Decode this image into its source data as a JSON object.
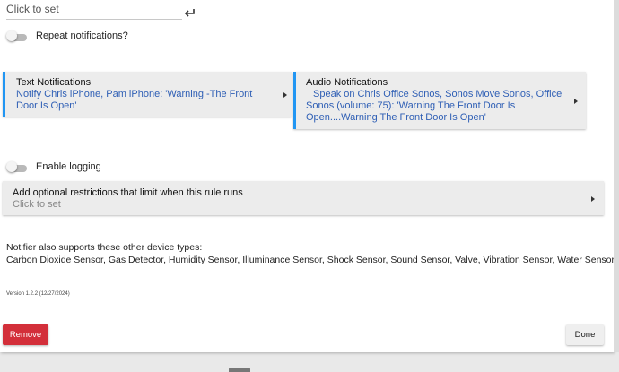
{
  "top_input": {
    "placeholder": "Click to set"
  },
  "repeat": {
    "label": "Repeat notifications?"
  },
  "text_card": {
    "title": "Text Notifications",
    "body": "Notify Chris iPhone, Pam iPhone: 'Warning -The  Front Door Is Open'"
  },
  "audio_card": {
    "title": "Audio Notifications",
    "body": "Speak on Chris Office Sonos, Sonos Move Sonos, Office Sonos (volume: 75): 'Warning The Front Door Is Open....Warning The Front Door Is Open'"
  },
  "logging": {
    "label": "Enable logging"
  },
  "restrictions": {
    "title": "Add optional restrictions that limit when this rule runs",
    "value": "Click to set"
  },
  "info": {
    "line1": "Notifier also supports these other device types:",
    "line2": "Carbon Dioxide Sensor, Gas Detector, Humidity Sensor, Illuminance Sensor, Shock Sensor, Sound Sensor, Valve, Vibration Sensor, Water Sensor"
  },
  "version": "Version 1.2.2 (12/27/2024)",
  "buttons": {
    "remove": "Remove",
    "done": "Done"
  },
  "colors": {
    "accent": "#2196f3",
    "remove": "#d32f3a",
    "link": "#2f5fb5"
  }
}
